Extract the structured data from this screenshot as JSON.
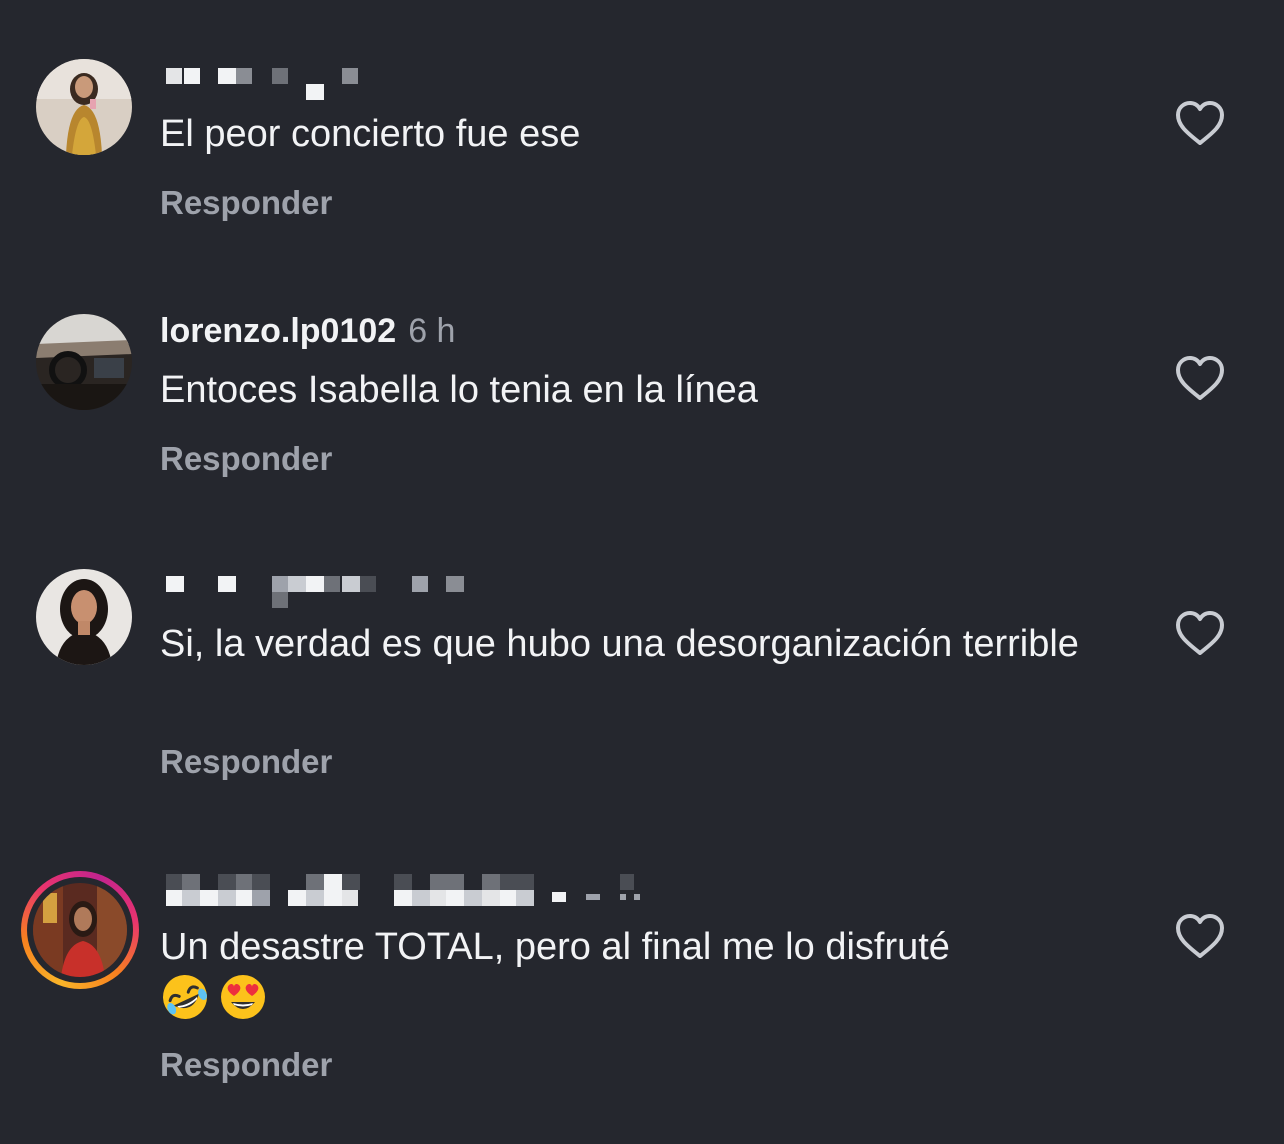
{
  "comments": [
    {
      "username": "",
      "time": "",
      "text": "El peor concierto fue ese",
      "reply_label": "Responder",
      "has_story_ring": false
    },
    {
      "username": "lorenzo.lp0102",
      "time": "6 h",
      "text": "Entoces Isabella lo tenia en la línea",
      "reply_label": "Responder",
      "has_story_ring": false
    },
    {
      "username": "",
      "time": "",
      "text": "Si, la verdad es que hubo una desorganización terrible",
      "reply_label": "Responder",
      "has_story_ring": false
    },
    {
      "username": "",
      "time": "",
      "text": "Un desastre TOTAL, pero al final me lo disfruté",
      "emojis": [
        "rolling-on-floor-laughing-emoji",
        "heart-eyes-emoji"
      ],
      "reply_label": "Responder",
      "has_story_ring": true
    }
  ],
  "colors": {
    "background": "#25272e",
    "text": "#f2f3f5",
    "muted": "#9ea2ab",
    "story_ring_start": "#f9b429",
    "story_ring_end": "#c2248f"
  }
}
